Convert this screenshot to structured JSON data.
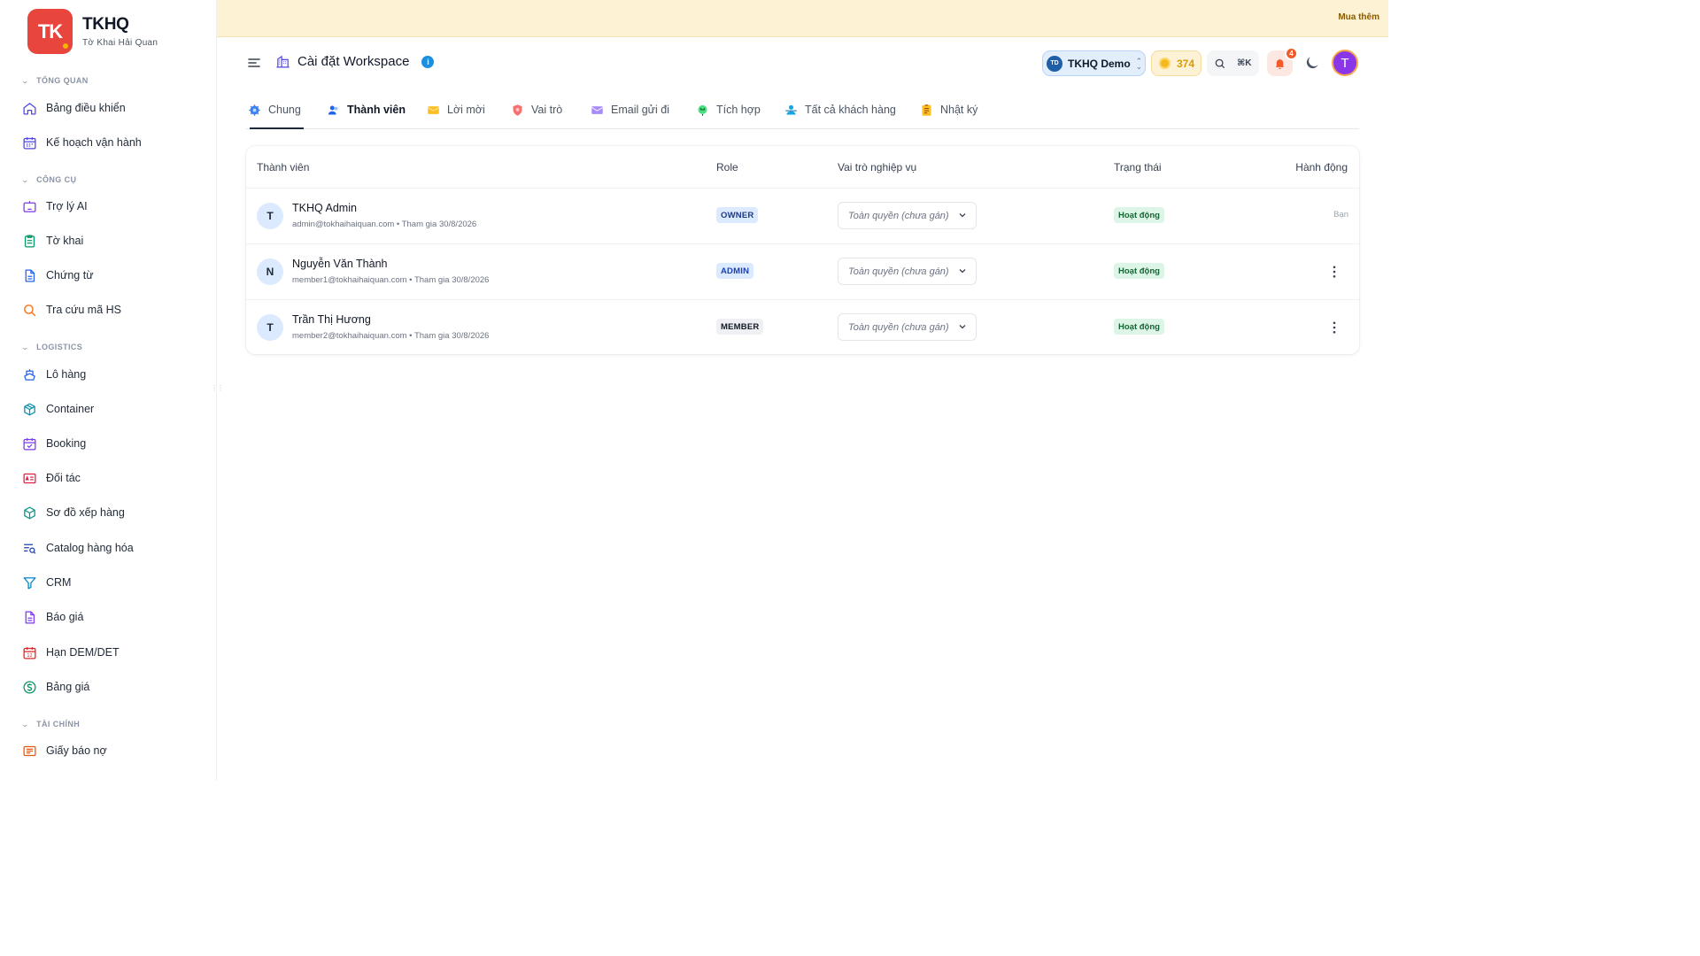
{
  "brand": {
    "logo_text": "TK",
    "name": "TKHQ",
    "subtitle": "Tờ Khai Hải Quan"
  },
  "sidebar": {
    "sections": [
      {
        "label": "TỔNG QUAN"
      },
      {
        "label": "CÔNG CỤ"
      },
      {
        "label": "LOGISTICS"
      },
      {
        "label": "TÀI CHÍNH"
      }
    ],
    "items": [
      {
        "label": "Bảng điều khiển",
        "icon": "home-icon"
      },
      {
        "label": "Kế hoạch vận hành",
        "icon": "calendar-icon"
      },
      {
        "label": "Trợ lý AI",
        "icon": "ai-assistant-icon"
      },
      {
        "label": "Tờ khai",
        "icon": "clipboard-icon"
      },
      {
        "label": "Chứng từ",
        "icon": "document-icon"
      },
      {
        "label": "Tra cứu mã HS",
        "icon": "search-icon"
      },
      {
        "label": "Lô hàng",
        "icon": "ship-icon"
      },
      {
        "label": "Container",
        "icon": "box-icon"
      },
      {
        "label": "Booking",
        "icon": "calendar-check-icon"
      },
      {
        "label": "Đối tác",
        "icon": "contact-card-icon"
      },
      {
        "label": "Sơ đồ xếp hàng",
        "icon": "cube-icon"
      },
      {
        "label": "Catalog hàng hóa",
        "icon": "list-search-icon"
      },
      {
        "label": "CRM",
        "icon": "funnel-icon"
      },
      {
        "label": "Báo giá",
        "icon": "quote-document-icon"
      },
      {
        "label": "Hạn DEM/DET",
        "icon": "calendar-12-icon"
      },
      {
        "label": "Bảng giá",
        "icon": "dollar-circle-icon"
      },
      {
        "label": "Giấy báo nợ",
        "icon": "receipt-icon"
      }
    ]
  },
  "banner": {
    "link_label": "Mua thêm"
  },
  "header": {
    "title": "Cài đặt Workspace",
    "info_label": "i",
    "workspace": {
      "initials": "TD",
      "name": "TKHQ Demo"
    },
    "credits": "374",
    "search_shortcut": "⌘K",
    "notification_count": "4",
    "user_initial": "T"
  },
  "tabs": [
    {
      "label": "Chung",
      "icon": "gear-icon"
    },
    {
      "label": "Thành viên",
      "icon": "users-icon",
      "active": true
    },
    {
      "label": "Lời mời",
      "icon": "envelope-icon"
    },
    {
      "label": "Vai trò",
      "icon": "shield-icon"
    },
    {
      "label": "Email gửi đi",
      "icon": "mail-icon"
    },
    {
      "label": "Tích hợp",
      "icon": "plug-icon"
    },
    {
      "label": "Tất cả khách hàng",
      "icon": "customers-icon"
    },
    {
      "label": "Nhật ký",
      "icon": "log-icon"
    }
  ],
  "table": {
    "headers": [
      "Thành viên",
      "Role",
      "Vai trò nghiệp vụ",
      "Trạng thái",
      "Hành động"
    ],
    "rows": [
      {
        "initial": "T",
        "name": "TKHQ Admin",
        "sub": "admin@tokhaihaiquan.com • Tham gia 30/8/2026",
        "role": "OWNER",
        "business_role": "Toàn quyền (chưa gán)",
        "status": "Hoạt động",
        "action": "Bạn"
      },
      {
        "initial": "N",
        "name": "Nguyễn Văn Thành",
        "sub": "member1@tokhaihaiquan.com • Tham gia 30/8/2026",
        "role": "ADMIN",
        "business_role": "Toàn quyền (chưa gán)",
        "status": "Hoạt động",
        "action": ""
      },
      {
        "initial": "T",
        "name": "Trần Thị Hương",
        "sub": "member2@tokhaihaiquan.com • Tham gia 30/8/2026",
        "role": "MEMBER",
        "business_role": "Toàn quyền (chưa gán)",
        "status": "Hoạt động",
        "action": ""
      }
    ]
  },
  "colors": {
    "brand": "#e8453c",
    "accent": "#1d8fe0",
    "status_active": "#dcf5e7",
    "banner": "#fdf3d4"
  }
}
